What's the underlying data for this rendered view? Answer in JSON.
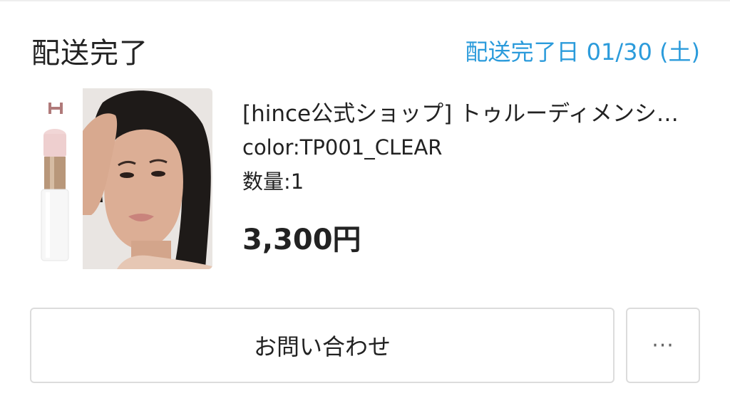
{
  "order": {
    "status": "配送完了",
    "delivered_label": "配送完了日 01/30 (土)"
  },
  "product": {
    "name": "[hince公式ショップ] トゥルーディメンションラディアンスバーム",
    "color": "color:TP001_CLEAR",
    "quantity": "数量:1",
    "price": "3,300円",
    "brand_logo_text": "H"
  },
  "actions": {
    "contact_label": "お問い合わせ",
    "more_label": "···"
  },
  "colors": {
    "accent": "#2b9bdb",
    "border": "#dcdcdc",
    "text": "#222222"
  }
}
